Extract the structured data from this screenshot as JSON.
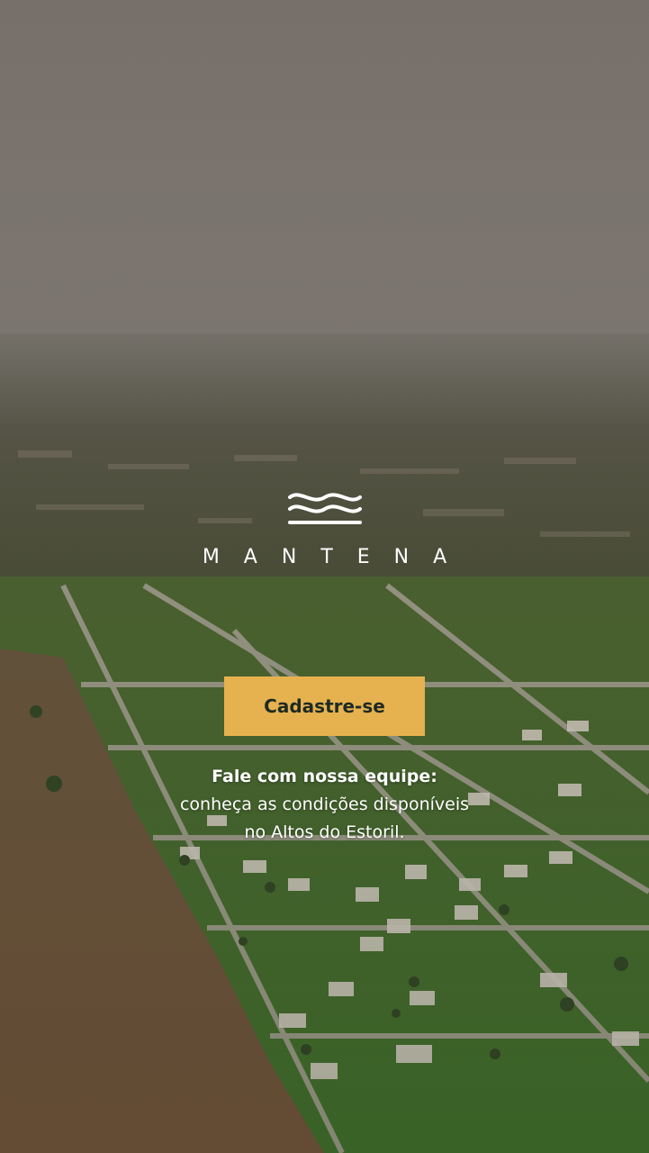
{
  "brand": {
    "name": "MANTENA",
    "logo_icon": "waves-logo-icon"
  },
  "cta": {
    "label": "Cadastre-se"
  },
  "message": {
    "headline": "Fale com nossa equipe:",
    "line1": "conheça as condições disponíveis",
    "line2": "no Altos do Estoril."
  },
  "colors": {
    "accent": "#e6b24f",
    "button_text": "#1f2a24",
    "text": "#ffffff",
    "sky": "#7a726b"
  }
}
